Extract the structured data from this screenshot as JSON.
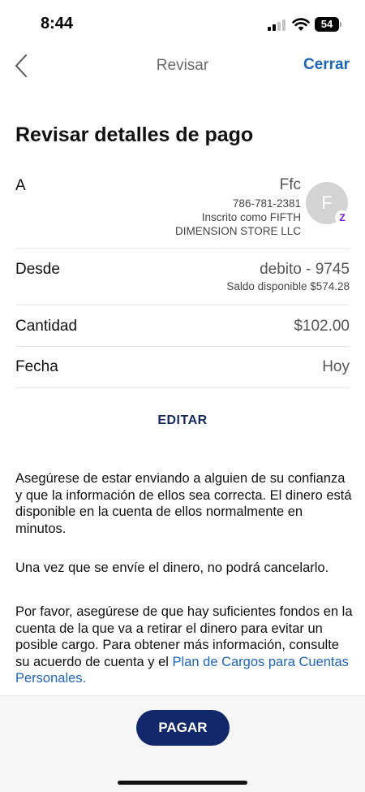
{
  "status_bar": {
    "time": "8:44",
    "battery": "54"
  },
  "nav": {
    "title": "Revisar",
    "close_label": "Cerrar"
  },
  "page_title": "Revisar detalles de pago",
  "recipient": {
    "label": "A",
    "name": "Ffc",
    "phone": "786-781-2381",
    "enrolled_line1": "Inscrito como FIFTH",
    "enrolled_line2": "DIMENSION STORE LLC",
    "avatar_initial": "F",
    "badge": "Z"
  },
  "from": {
    "label": "Desde",
    "account": "debito - 9745",
    "balance": "Saldo disponible $574.28"
  },
  "amount": {
    "label": "Cantidad",
    "value": "$102.00"
  },
  "date": {
    "label": "Fecha",
    "value": "Hoy"
  },
  "edit_label": "EDITAR",
  "disclaimers": {
    "p1": "Asegúrese de estar enviando a alguien de su confianza y que la información de ellos sea correcta. El dinero está disponible en la cuenta de ellos normalmente en minutos.",
    "p2": "Una vez que se envíe el dinero, no podrá cancelarlo.",
    "p3_text": "Por favor, asegúrese de que hay suficientes fondos en la cuenta de la que va a retirar el dinero para evitar un posible cargo. Para obtener más información, consulte su acuerdo de cuenta y el ",
    "p3_link": "Plan de Cargos para Cuentas Personales."
  },
  "pay_label": "PAGAR"
}
